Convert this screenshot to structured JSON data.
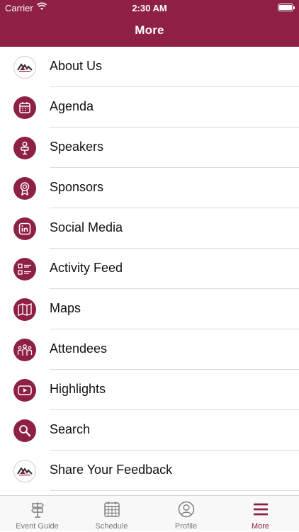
{
  "status_bar": {
    "carrier": "Carrier",
    "time": "2:30 AM"
  },
  "header": {
    "title": "More"
  },
  "menu": [
    {
      "label": "About Us",
      "icon": "event-logo-icon"
    },
    {
      "label": "Agenda",
      "icon": "calendar-icon"
    },
    {
      "label": "Speakers",
      "icon": "speaker-icon"
    },
    {
      "label": "Sponsors",
      "icon": "award-icon"
    },
    {
      "label": "Social Media",
      "icon": "linkedin-icon"
    },
    {
      "label": "Activity Feed",
      "icon": "feed-list-icon"
    },
    {
      "label": "Maps",
      "icon": "map-icon"
    },
    {
      "label": "Attendees",
      "icon": "people-icon"
    },
    {
      "label": "Highlights",
      "icon": "video-icon"
    },
    {
      "label": "Search",
      "icon": "search-icon"
    },
    {
      "label": "Share Your Feedback",
      "icon": "event-logo-icon"
    }
  ],
  "tabbar": [
    {
      "label": "Event Guide",
      "icon": "signpost-icon"
    },
    {
      "label": "Schedule",
      "icon": "calendar-grid-icon"
    },
    {
      "label": "Profile",
      "icon": "user-circle-icon"
    },
    {
      "label": "More",
      "icon": "menu-icon",
      "active": true
    }
  ],
  "colors": {
    "brand": "#8e1f45",
    "tab_inactive": "#7a7a7a"
  }
}
